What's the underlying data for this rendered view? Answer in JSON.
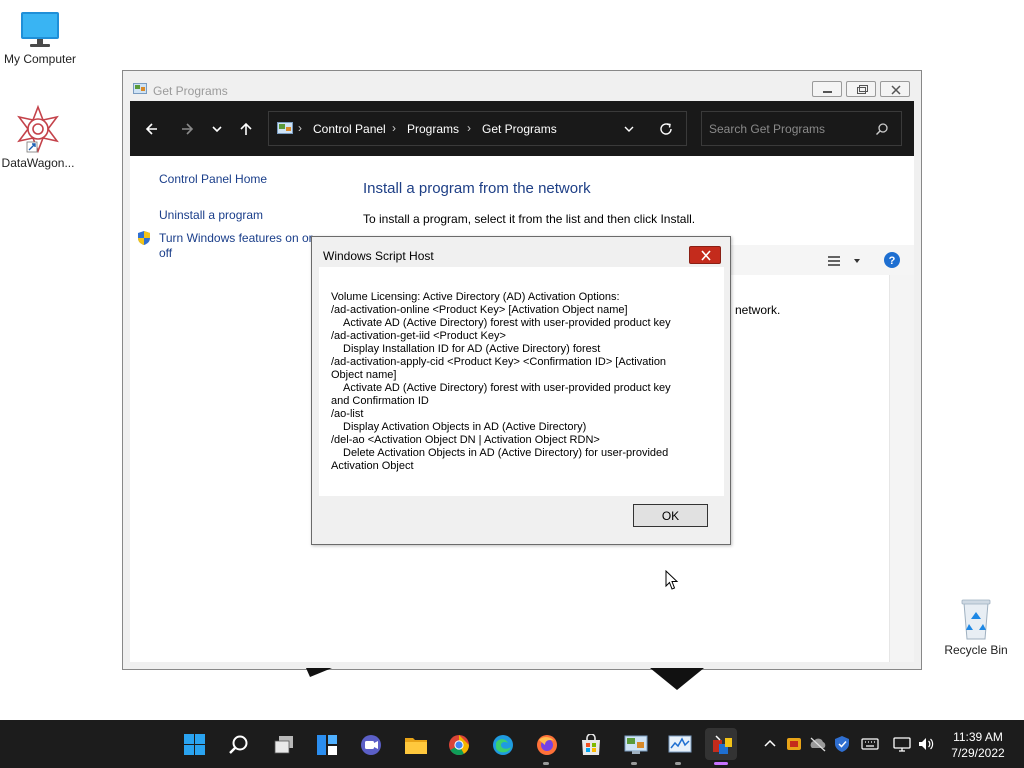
{
  "desktop": {
    "icons": [
      {
        "label": "My Computer",
        "icon": "monitor-icon"
      },
      {
        "label": "DataWagon...",
        "icon": "datawagon-icon"
      },
      {
        "label": "Recycle Bin",
        "icon": "recycle-bin-icon"
      }
    ]
  },
  "window": {
    "title": "Get Programs",
    "breadcrumb": [
      "Control Panel",
      "Programs",
      "Get Programs"
    ],
    "search_placeholder": "Search Get Programs",
    "left_links": [
      "Control Panel Home",
      "Uninstall a program",
      "Turn Windows features on or",
      "off"
    ],
    "heading": "Install a program from the network",
    "description": "To install a program, select it from the list and then click Install.",
    "partial_text": "network."
  },
  "dialog": {
    "title": "Windows Script Host",
    "lines": [
      "Volume Licensing: Active Directory (AD) Activation Options:",
      "/ad-activation-online <Product Key> [Activation Object name]",
      "Activate AD (Active Directory) forest with user-provided product key",
      "/ad-activation-get-iid <Product Key>",
      "Display Installation ID for AD (Active Directory) forest",
      "/ad-activation-apply-cid <Product Key> <Confirmation ID> [Activation",
      "Object name]",
      "Activate AD (Active Directory) forest with user-provided product key",
      "and Confirmation ID",
      "/ao-list",
      "Display Activation Objects in AD (Active Directory)",
      "/del-ao <Activation Object DN | Activation Object RDN>",
      "Delete Activation Objects in AD (Active Directory) for user-provided",
      "Activation Object"
    ],
    "ok_label": "OK"
  },
  "taskbar": {
    "apps": [
      "start-icon",
      "search-icon",
      "task-view-icon",
      "widgets-icon",
      "chat-icon",
      "file-explorer-icon",
      "chrome-icon",
      "edge-icon",
      "firefox-icon",
      "store-icon",
      "control-panel-icon",
      "monitor-graph-icon",
      "app-icon"
    ],
    "time": "11:39 AM",
    "date": "7/29/2022"
  },
  "colors": {
    "accent": "#1e3f86",
    "link": "#1a3e8a",
    "close_red": "#c42b1c",
    "taskbar": "#1c1c1c"
  }
}
